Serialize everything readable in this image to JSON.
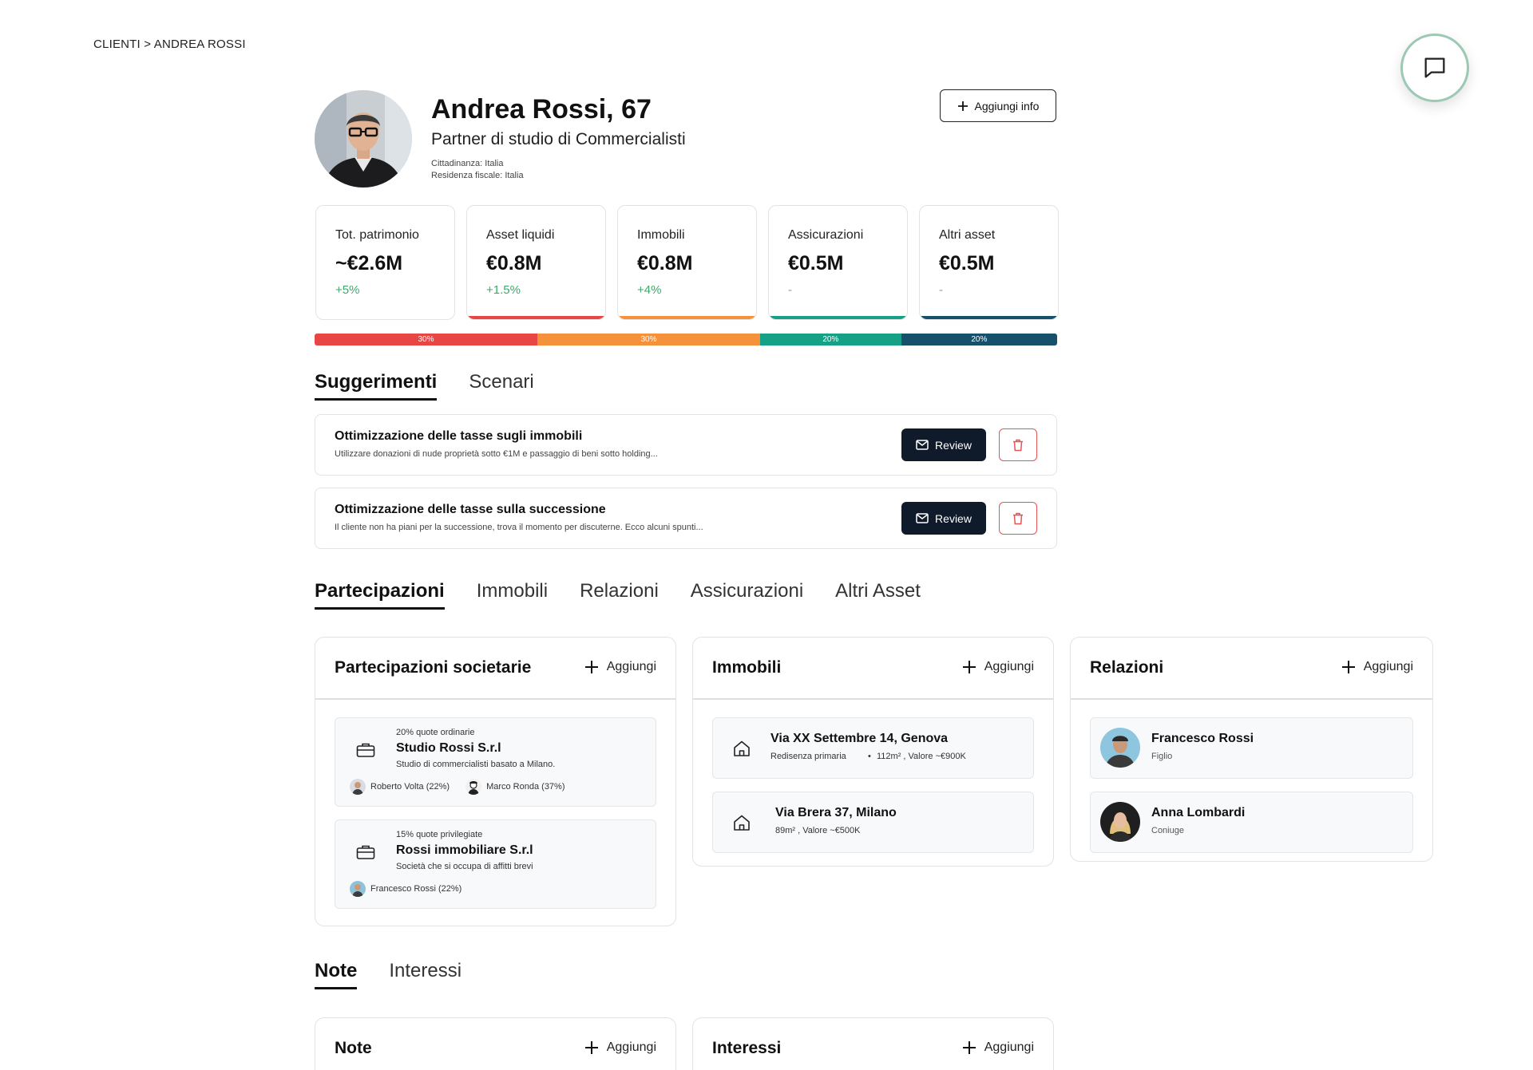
{
  "breadcrumb": "CLIENTI > ANDREA ROSSI",
  "profile": {
    "name": "Andrea Rossi, 67",
    "role": "Partner di studio di Commercialisti",
    "citizenship": "Cittadinanza: Italia",
    "tax_residence": "Residenza fiscale: Italia",
    "add_info_label": "Aggiungi info"
  },
  "kpis": [
    {
      "label": "Tot. patrimonio",
      "value": "~€2.6M",
      "change": "+5%",
      "color": ""
    },
    {
      "label": "Asset liquidi",
      "value": "€0.8M",
      "change": "+1.5%",
      "color": "#e84545"
    },
    {
      "label": "Immobili",
      "value": "€0.8M",
      "change": "+4%",
      "color": "#f5913a"
    },
    {
      "label": "Assicurazioni",
      "value": "€0.5M",
      "change": "-",
      "color": "#16a085"
    },
    {
      "label": "Altri asset",
      "value": "€0.5M",
      "change": "-",
      "color": "#17506a"
    }
  ],
  "allocation": [
    {
      "label": "30%",
      "share": 30,
      "color": "#e84545"
    },
    {
      "label": "30%",
      "share": 30,
      "color": "#f5913a"
    },
    {
      "label": "20%",
      "share": 19,
      "color": "#16a085"
    },
    {
      "label": "20%",
      "share": 21,
      "color": "#17506a"
    }
  ],
  "suggestion_tabs": [
    "Suggerimenti",
    "Scenari"
  ],
  "suggestions": [
    {
      "title": "Ottimizzazione delle tasse sugli immobili",
      "desc": "Utilizzare donazioni di nude proprietà sotto €1M e passaggio di beni sotto holding...",
      "review": "Review"
    },
    {
      "title": "Ottimizzazione delle tasse sulla successione",
      "desc": "Il cliente non ha piani per la successione, trova il momento per discuterne. Ecco alcuni spunti...",
      "review": "Review"
    }
  ],
  "asset_tabs": [
    "Partecipazioni",
    "Immobili",
    "Relazioni",
    "Assicurazioni",
    "Altri Asset"
  ],
  "add_label": "Aggiungi",
  "participations": {
    "title": "Partecipazioni societarie",
    "items": [
      {
        "share": "20% quote ordinarie",
        "name": "Studio Rossi S.r.l",
        "desc": "Studio di commercialisti basato a Milano.",
        "people": [
          "Roberto Volta (22%)",
          "Marco Ronda (37%)"
        ]
      },
      {
        "share": "15% quote privilegiate",
        "name": "Rossi immobiliare S.r.l",
        "desc": "Società che si occupa di affitti brevi",
        "people": [
          "Francesco Rossi (22%)"
        ]
      }
    ]
  },
  "real_estate": {
    "title": "Immobili",
    "items": [
      {
        "address": "Via XX Settembre 14, Genova",
        "tag": "Redisenza primaria",
        "details": "112m² , Valore ~€900K"
      },
      {
        "address": "Via Brera 37, Milano",
        "tag": "",
        "details": "89m² , Valore ~€500K"
      }
    ]
  },
  "relations": {
    "title": "Relazioni",
    "items": [
      {
        "name": "Francesco Rossi",
        "role": "Figlio"
      },
      {
        "name": "Anna Lombardi",
        "role": "Coniuge"
      }
    ]
  },
  "note_tabs": [
    "Note",
    "Interessi"
  ],
  "note_panel": {
    "title": "Note"
  },
  "interests_panel": {
    "title": "Interessi"
  },
  "icons": {
    "chat": "chat-bubble-icon",
    "plus": "plus-icon",
    "mail": "mail-icon",
    "trash": "trash-icon",
    "briefcase": "briefcase-icon",
    "home": "home-icon"
  }
}
